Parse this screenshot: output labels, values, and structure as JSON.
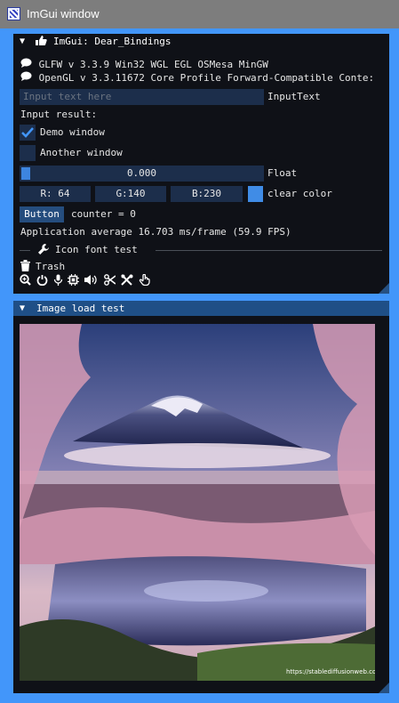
{
  "window": {
    "title": "ImGui window"
  },
  "panel1": {
    "title": "ImGui: Dear_Bindings",
    "glfw_line": "GLFW v 3.3.9 Win32 WGL EGL OSMesa MinGW",
    "opengl_line": "OpenGL v 3.3.11672 Core Profile Forward-Compatible Conte:",
    "input": {
      "placeholder": "Input text here",
      "value": "",
      "label": "InputText"
    },
    "input_result_label": "Input result:",
    "demo_window": {
      "label": "Demo window",
      "checked": true
    },
    "another_window": {
      "label": "Another window",
      "checked": false
    },
    "slider": {
      "value": "0.000",
      "label": "Float"
    },
    "color": {
      "r": "R: 64",
      "g": "G:140",
      "b": "B:230",
      "label": "clear color",
      "swatch": "#408ce6"
    },
    "button": {
      "label": "Button",
      "counter_text": "counter = 0"
    },
    "fps_text": "Application average 16.703 ms/frame (59.9 FPS)",
    "icon_font_test": "Icon font test",
    "trash_label": "Trash",
    "icon_row": [
      "search-plus-icon",
      "power-icon",
      "microphone-icon",
      "microchip-icon",
      "volume-icon",
      "scissors-icon",
      "tools-icon",
      "hand-pointer-icon"
    ]
  },
  "panel2": {
    "title": "Image load test",
    "watermark": "https://stablediffusionweb.com"
  },
  "colors": {
    "accent": "#4296fa",
    "frame_bg": "#1c2e4b",
    "window_bg": "#0f1117",
    "button": "#254d7e"
  }
}
